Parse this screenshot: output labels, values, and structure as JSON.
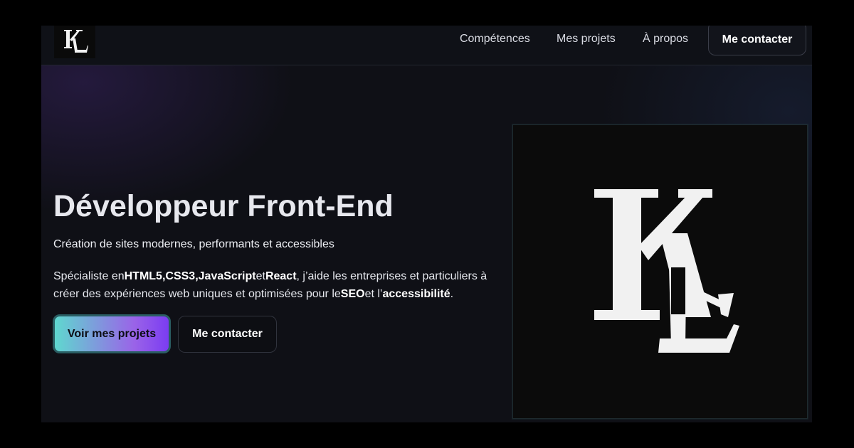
{
  "header": {
    "logo_alt": "KL",
    "nav": {
      "competences": "Compétences",
      "projets": "Mes projets",
      "apropos": "À propos",
      "contact": "Me contacter"
    }
  },
  "hero": {
    "title": "Développeur Front-End",
    "subtitle": "Création de sites modernes, performants et accessibles",
    "description": {
      "prefix": "Spécialiste en",
      "tech1": "HTML5",
      "sep1": ",",
      "tech2": "CSS3",
      "sep2": ",",
      "tech3": "JavaScript",
      "conj": "et",
      "tech4": "React",
      "middle": ", j’aide les entreprises et particuliers à créer des expériences web uniques et optimisées pour le",
      "kw1": "SEO",
      "conj2": "et l’",
      "kw2": "accessibilité",
      "end": "."
    },
    "buttons": {
      "primary": "Voir mes projets",
      "secondary": "Me contacter"
    },
    "image": {
      "logo_text": "KL"
    }
  },
  "colors": {
    "background": "#0f1016",
    "accent_start": "#5fd8cf",
    "accent_end": "#7b3cf2"
  }
}
